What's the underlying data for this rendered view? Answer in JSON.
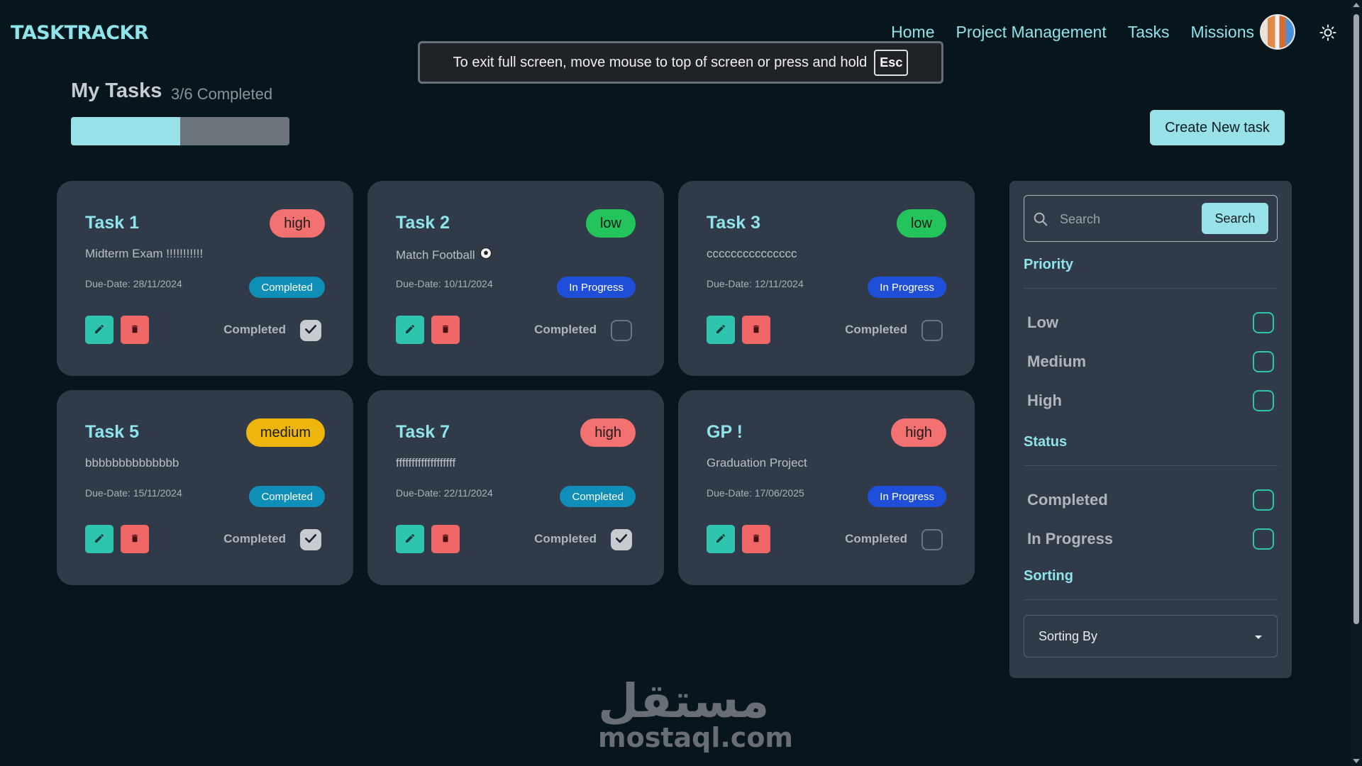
{
  "app": {
    "logo": "TASKTRACKR"
  },
  "nav": [
    {
      "label": "Home"
    },
    {
      "label": "Project Management"
    },
    {
      "label": "Tasks"
    },
    {
      "label": "Missions"
    }
  ],
  "toast": {
    "message": "To exit full screen, move mouse to top of screen or press and hold",
    "key": "Esc"
  },
  "page": {
    "title": "My Tasks",
    "subtitle": "3/6 Completed",
    "progress_fraction": 0.5
  },
  "create_button": "Create New task",
  "cards": [
    {
      "title": "Task 1",
      "priority": "high",
      "description": "Midterm Exam !!!!!!!!!!!",
      "due": "Due-Date: 28/11/2024",
      "status": "Completed",
      "checkbox_label": "Completed",
      "checked": true
    },
    {
      "title": "Task 2",
      "priority": "low",
      "description": "Match Football",
      "due": "Due-Date: 10/11/2024",
      "status": "In Progress",
      "checkbox_label": "Completed",
      "checked": false,
      "emoji": "soccer-ball-icon"
    },
    {
      "title": "Task 3",
      "priority": "low",
      "description": "ccccccccccccccc",
      "due": "Due-Date: 12/11/2024",
      "status": "In Progress",
      "checkbox_label": "Completed",
      "checked": false
    },
    {
      "title": "Task 5",
      "priority": "medium",
      "description": "bbbbbbbbbbbbbb",
      "due": "Due-Date: 15/11/2024",
      "status": "Completed",
      "checkbox_label": "Completed",
      "checked": true
    },
    {
      "title": "Task 7",
      "priority": "high",
      "description": "fffffffffffffffffff",
      "due": "Due-Date: 22/11/2024",
      "status": "Completed",
      "checkbox_label": "Completed",
      "checked": true
    },
    {
      "title": "GP !",
      "priority": "high",
      "description": "Graduation Project",
      "due": "Due-Date: 17/06/2025",
      "status": "In Progress",
      "checkbox_label": "Completed",
      "checked": false
    }
  ],
  "sidebar": {
    "search_placeholder": "Search",
    "search_button": "Search",
    "priority_title": "Priority",
    "priority_options": [
      "Low",
      "Medium",
      "High"
    ],
    "status_title": "Status",
    "status_options": [
      "Completed",
      "In Progress"
    ],
    "sorting_title": "Sorting",
    "sorting_value": "Sorting By"
  },
  "watermark": {
    "arabic": "مستقل",
    "latin": "mostaql.com"
  },
  "colors": {
    "accent": "#99e1e8",
    "card": "#313a48",
    "background": "#06161c",
    "high": "#f47171",
    "low": "#23c45b",
    "medium": "#eeb60d"
  }
}
